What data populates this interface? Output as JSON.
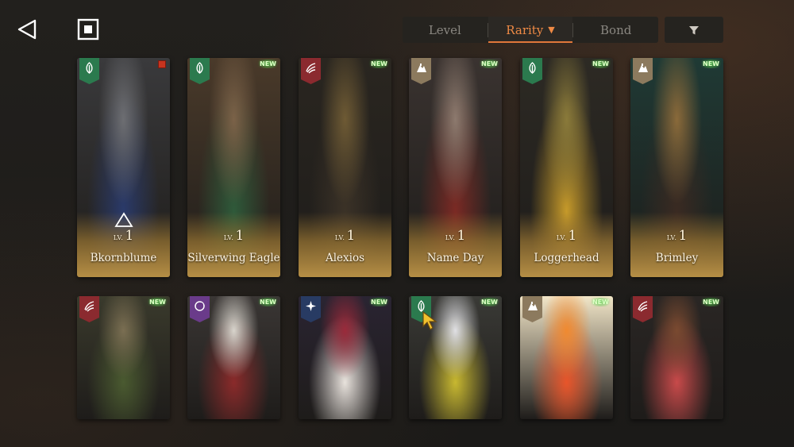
{
  "sort_bar": {
    "tabs": [
      {
        "label": "Level",
        "active": false
      },
      {
        "label": "Rarity",
        "active": true
      },
      {
        "label": "Bond",
        "active": false
      }
    ],
    "active_indicator": "▼"
  },
  "colors": {
    "accent": "#e0773a",
    "card_gold": "#b58e45",
    "new_green": "#4fd04a"
  },
  "characters": [
    {
      "name": "Bkornblume",
      "lv_label": "LV.",
      "level": "1",
      "afflatus": "plant",
      "new": "",
      "red_marker": true,
      "art": [
        "#3a3a3c",
        "#6d6e72",
        "#2a3a6a"
      ]
    },
    {
      "name": "Silverwing Eagle",
      "lv_label": "LV.",
      "level": "1",
      "afflatus": "plant",
      "new": "NEW",
      "red_marker": false,
      "art": [
        "#4a3a2a",
        "#7b6248",
        "#2f5a3a"
      ]
    },
    {
      "name": "Alexios",
      "lv_label": "LV.",
      "level": "1",
      "afflatus": "beast",
      "new": "NEW",
      "red_marker": false,
      "art": [
        "#2a2620",
        "#6e5a34",
        "#3b3227"
      ]
    },
    {
      "name": "Name Day",
      "lv_label": "LV.",
      "level": "1",
      "afflatus": "rock",
      "new": "NEW",
      "red_marker": false,
      "art": [
        "#3a3330",
        "#8d7a6e",
        "#7b2a24"
      ]
    },
    {
      "name": "Loggerhead",
      "lv_label": "LV.",
      "level": "1",
      "afflatus": "plant",
      "new": "NEW",
      "red_marker": false,
      "art": [
        "#2d2a24",
        "#8a7a3a",
        "#c69a2a"
      ]
    },
    {
      "name": "Brimley",
      "lv_label": "LV.",
      "level": "1",
      "afflatus": "rock",
      "new": "NEW",
      "red_marker": false,
      "art": [
        "#1f3a35",
        "#8a6a3a",
        "#3a2a22"
      ]
    },
    {
      "name": "",
      "lv_label": "",
      "level": "",
      "afflatus": "beast",
      "new": "NEW",
      "red_marker": false,
      "art": [
        "#3a3a2c",
        "#7a6e52",
        "#4a5a30"
      ]
    },
    {
      "name": "",
      "lv_label": "",
      "level": "",
      "afflatus": "mind",
      "new": "NEW",
      "red_marker": false,
      "art": [
        "#3a3634",
        "#d8d4cc",
        "#8a2a2a"
      ]
    },
    {
      "name": "",
      "lv_label": "",
      "level": "",
      "afflatus": "star",
      "new": "NEW",
      "red_marker": false,
      "art": [
        "#2a2432",
        "#9a2a3a",
        "#e8e2dc"
      ]
    },
    {
      "name": "",
      "lv_label": "",
      "level": "",
      "afflatus": "plant",
      "new": "NEW",
      "red_marker": false,
      "art": [
        "#3a3a36",
        "#e0e0e4",
        "#c8b830"
      ]
    },
    {
      "name": "",
      "lv_label": "",
      "level": "",
      "afflatus": "rock",
      "new": "NEW",
      "red_marker": false,
      "art": [
        "#f2e6c8",
        "#f08a30",
        "#e8552a"
      ]
    },
    {
      "name": "",
      "lv_label": "",
      "level": "",
      "afflatus": "beast",
      "new": "NEW",
      "red_marker": false,
      "art": [
        "#2a2624",
        "#7a4a30",
        "#c84a4a"
      ]
    }
  ]
}
